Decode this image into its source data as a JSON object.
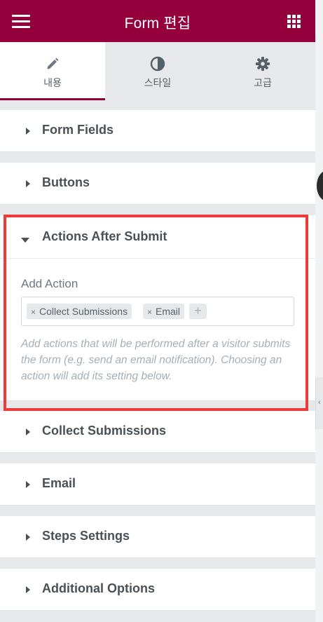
{
  "header": {
    "title": "Form 편집",
    "menu_icon": "hamburger-menu-icon",
    "grid_icon": "apps-grid-icon",
    "background": "#93003c"
  },
  "tabs": [
    {
      "label": "내용",
      "icon": "pencil-icon",
      "active": true
    },
    {
      "label": "스타일",
      "icon": "half-circle-contrast-icon",
      "active": false
    },
    {
      "label": "고급",
      "icon": "gear-icon",
      "active": false
    }
  ],
  "sections": {
    "form_fields": {
      "title": "Form Fields"
    },
    "buttons": {
      "title": "Buttons"
    },
    "actions_after_submit": {
      "title": "Actions After Submit",
      "expanded": true,
      "add_action_label": "Add Action",
      "selected_actions": [
        "Collect Submissions",
        "Email"
      ],
      "add_button": "+",
      "remove_glyph": "×",
      "help_text": "Add actions that will be performed after a visitor submits the form (e.g. send an email notification). Choosing an action will add its setting below."
    },
    "collect_submissions": {
      "title": "Collect Submissions"
    },
    "email": {
      "title": "Email"
    },
    "steps_settings": {
      "title": "Steps Settings"
    },
    "additional_options": {
      "title": "Additional Options"
    }
  },
  "colors": {
    "accent": "#93003c",
    "highlight": "#ee3a3a",
    "text": "#495157",
    "muted": "#a4afb7"
  }
}
